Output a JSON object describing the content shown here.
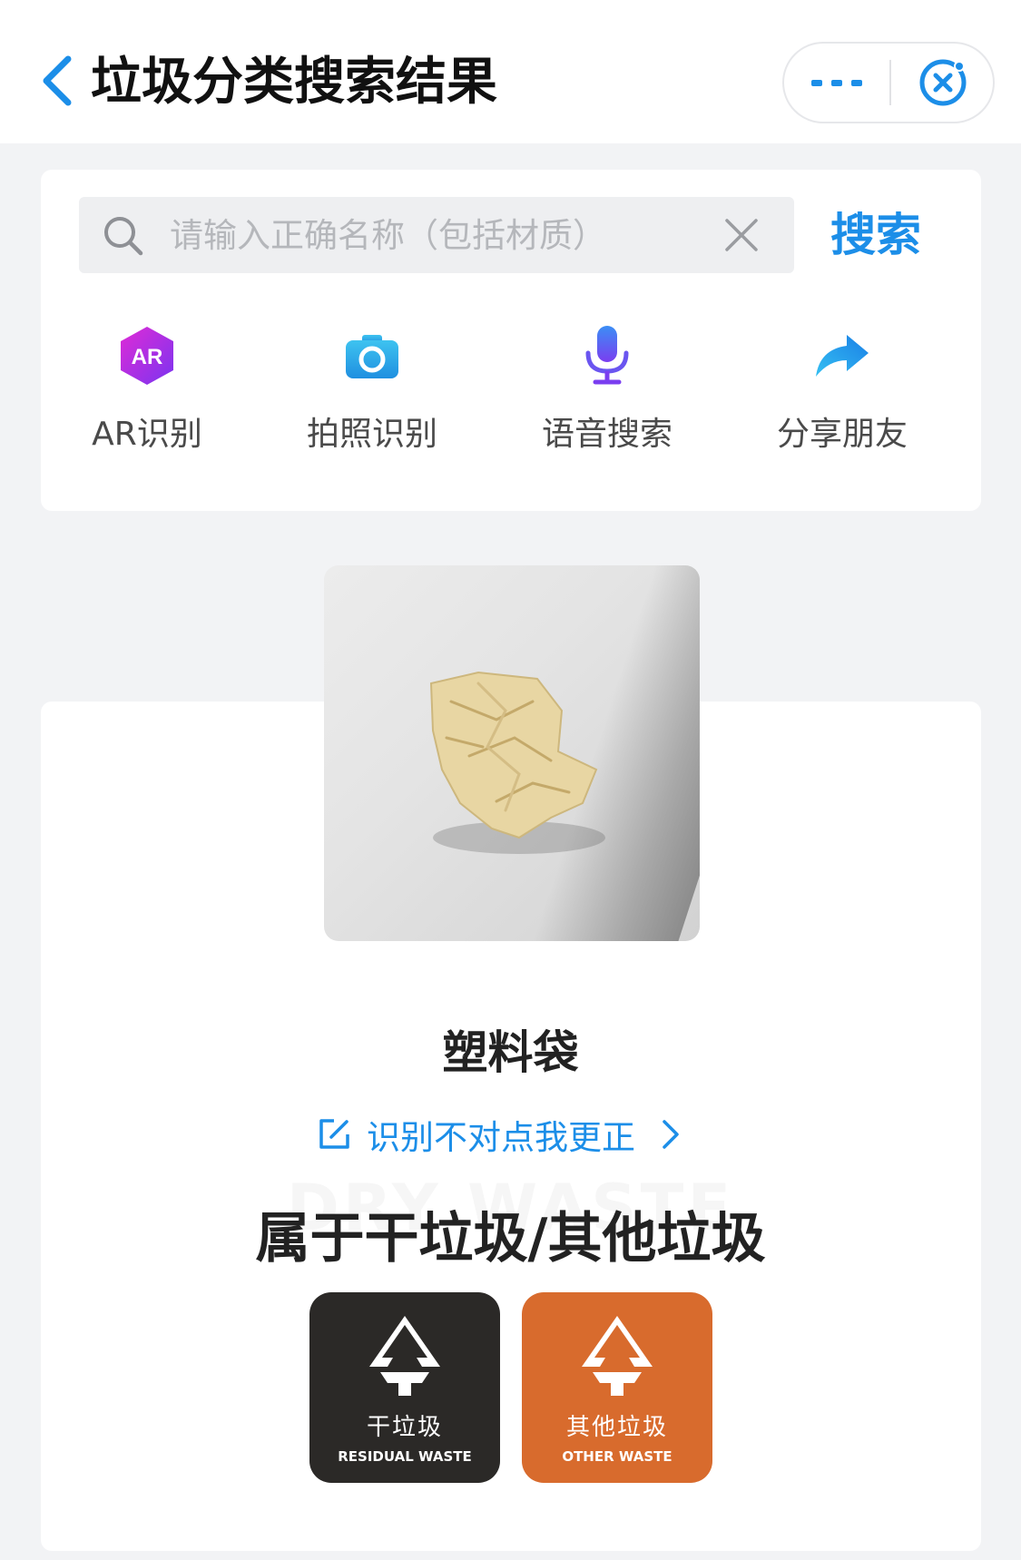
{
  "header": {
    "title": "垃圾分类搜索结果"
  },
  "search": {
    "placeholder": "请输入正确名称（包括材质）",
    "value": "",
    "submit_label": "搜索"
  },
  "tools": [
    {
      "label": "AR识别",
      "icon": "ar-icon",
      "icon_text": "AR"
    },
    {
      "label": "拍照识别",
      "icon": "camera-icon"
    },
    {
      "label": "语音搜索",
      "icon": "microphone-icon"
    },
    {
      "label": "分享朋友",
      "icon": "share-arrow-icon"
    }
  ],
  "result": {
    "item_name": "塑料袋",
    "correction_link": "识别不对点我更正",
    "watermark": "DRY WASTE",
    "category_text": "属于干垃圾/其他垃圾",
    "badges": [
      {
        "cn": "干垃圾",
        "en": "RESIDUAL WASTE",
        "color": "#2b2927"
      },
      {
        "cn": "其他垃圾",
        "en": "OTHER WASTE",
        "color": "#d86b2d"
      }
    ]
  },
  "colors": {
    "accent": "#1c8ee8",
    "background": "#f2f3f5"
  }
}
